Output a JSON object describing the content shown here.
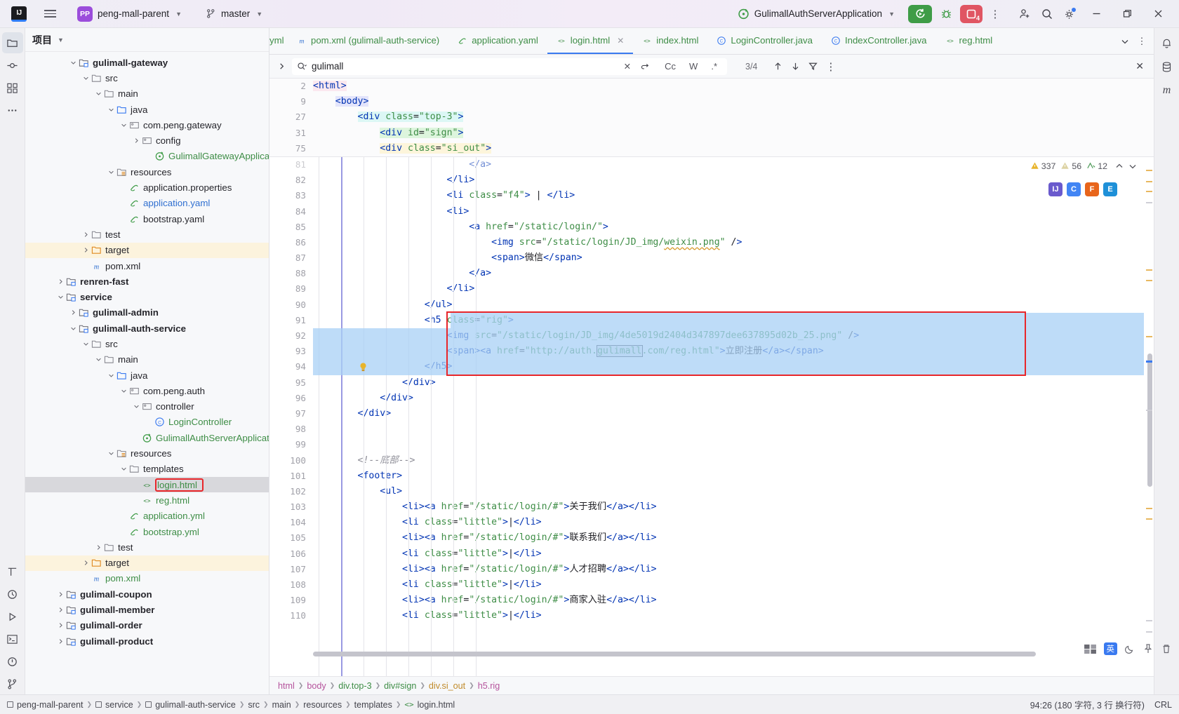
{
  "titlebar": {
    "logo": "IJ",
    "menu_icon": "hamburger-icon",
    "project_badge": "PP",
    "project_name": "peng-mall-parent",
    "branch_icon": "git-branch-icon",
    "branch_name": "master",
    "run_config": "GulimallAuthServerApplication",
    "run_button": "run-icon",
    "debug_button": "debug-icon",
    "stop_button_count": "4",
    "more_button": "more-vertical-icon",
    "account_icon": "add-account-icon",
    "search_icon": "search-icon",
    "settings_icon": "gear-icon",
    "minimize": "minimize-icon",
    "maximize": "restore-icon",
    "close": "close-icon"
  },
  "left_stripe": {
    "items": [
      {
        "name": "project-tool-window",
        "icon": "folder-icon"
      },
      {
        "name": "commit-tool-window",
        "icon": "commit-icon"
      },
      {
        "name": "structure-tool-window",
        "icon": "structure-icon"
      },
      {
        "name": "more-tool-windows",
        "icon": "ellipsis-icon"
      }
    ],
    "bottom_items": [
      {
        "name": "tool-window-todo",
        "icon": "todo-icon"
      },
      {
        "name": "tool-window-profiler",
        "icon": "profiler-icon"
      },
      {
        "name": "tool-window-run",
        "icon": "run-triangle-icon"
      },
      {
        "name": "tool-window-terminal",
        "icon": "terminal-icon"
      },
      {
        "name": "tool-window-problems",
        "icon": "problems-icon"
      },
      {
        "name": "tool-window-git",
        "icon": "git-icon"
      }
    ]
  },
  "right_stripe": {
    "items": [
      {
        "name": "notifications",
        "icon": "bell-icon"
      },
      {
        "name": "database",
        "icon": "database-icon"
      },
      {
        "name": "maven",
        "icon": "maven-m-icon"
      }
    ]
  },
  "project_panel": {
    "title": "项目",
    "chevron": "chevron-down-icon",
    "tree": [
      {
        "depth": 3,
        "arrow": "down",
        "icon": "module",
        "label": "gulimall-gateway",
        "style": "bold"
      },
      {
        "depth": 4,
        "arrow": "down",
        "icon": "folder",
        "label": "src",
        "style": ""
      },
      {
        "depth": 5,
        "arrow": "down",
        "icon": "folder",
        "label": "main",
        "style": ""
      },
      {
        "depth": 6,
        "arrow": "down",
        "icon": "srcfolder",
        "label": "java",
        "style": ""
      },
      {
        "depth": 7,
        "arrow": "down",
        "icon": "package",
        "label": "com.peng.gateway",
        "style": ""
      },
      {
        "depth": 8,
        "arrow": "right",
        "icon": "package",
        "label": "config",
        "style": ""
      },
      {
        "depth": 9,
        "arrow": "none",
        "icon": "springboot",
        "label": "GulimallGatewayApplication",
        "style": "green"
      },
      {
        "depth": 6,
        "arrow": "down",
        "icon": "resfolder",
        "label": "resources",
        "style": ""
      },
      {
        "depth": 7,
        "arrow": "none",
        "icon": "yaml",
        "label": "application.properties",
        "style": ""
      },
      {
        "depth": 7,
        "arrow": "none",
        "icon": "yaml",
        "label": "application.yaml",
        "style": "bluelink"
      },
      {
        "depth": 7,
        "arrow": "none",
        "icon": "yaml",
        "label": "bootstrap.yaml",
        "style": ""
      },
      {
        "depth": 4,
        "arrow": "right",
        "icon": "folder",
        "label": "test",
        "style": ""
      },
      {
        "depth": 4,
        "arrow": "right",
        "icon": "targetfolder",
        "label": "target",
        "style": "",
        "row_style": "target"
      },
      {
        "depth": 4,
        "arrow": "none",
        "icon": "maven",
        "label": "pom.xml",
        "style": ""
      },
      {
        "depth": 2,
        "arrow": "right",
        "icon": "module",
        "label": "renren-fast",
        "style": "bold"
      },
      {
        "depth": 2,
        "arrow": "down",
        "icon": "module",
        "label": "service",
        "style": "bold"
      },
      {
        "depth": 3,
        "arrow": "right",
        "icon": "module",
        "label": "gulimall-admin",
        "style": "bold"
      },
      {
        "depth": 3,
        "arrow": "down",
        "icon": "module",
        "label": "gulimall-auth-service",
        "style": "bold"
      },
      {
        "depth": 4,
        "arrow": "down",
        "icon": "folder",
        "label": "src",
        "style": ""
      },
      {
        "depth": 5,
        "arrow": "down",
        "icon": "folder",
        "label": "main",
        "style": ""
      },
      {
        "depth": 6,
        "arrow": "down",
        "icon": "srcfolder",
        "label": "java",
        "style": ""
      },
      {
        "depth": 7,
        "arrow": "down",
        "icon": "package",
        "label": "com.peng.auth",
        "style": ""
      },
      {
        "depth": 8,
        "arrow": "down",
        "icon": "package",
        "label": "controller",
        "style": ""
      },
      {
        "depth": 9,
        "arrow": "none",
        "icon": "class",
        "label": "LoginController",
        "style": "green"
      },
      {
        "depth": 8,
        "arrow": "none",
        "icon": "springboot",
        "label": "GulimallAuthServerApplication",
        "style": "green"
      },
      {
        "depth": 6,
        "arrow": "down",
        "icon": "resfolder",
        "label": "resources",
        "style": ""
      },
      {
        "depth": 7,
        "arrow": "down",
        "icon": "folder",
        "label": "templates",
        "style": ""
      },
      {
        "depth": 8,
        "arrow": "none",
        "icon": "html",
        "label": "login.html",
        "style": "green",
        "row_style": "selected",
        "boxed": true
      },
      {
        "depth": 8,
        "arrow": "none",
        "icon": "html",
        "label": "reg.html",
        "style": "green"
      },
      {
        "depth": 7,
        "arrow": "none",
        "icon": "yaml",
        "label": "application.yml",
        "style": "green"
      },
      {
        "depth": 7,
        "arrow": "none",
        "icon": "yaml",
        "label": "bootstrap.yml",
        "style": "green"
      },
      {
        "depth": 5,
        "arrow": "right",
        "icon": "folder",
        "label": "test",
        "style": ""
      },
      {
        "depth": 4,
        "arrow": "right",
        "icon": "targetfolder",
        "label": "target",
        "style": "",
        "row_style": "target"
      },
      {
        "depth": 4,
        "arrow": "none",
        "icon": "maven",
        "label": "pom.xml",
        "style": "green"
      },
      {
        "depth": 2,
        "arrow": "right",
        "icon": "module",
        "label": "gulimall-coupon",
        "style": "bold"
      },
      {
        "depth": 2,
        "arrow": "right",
        "icon": "module",
        "label": "gulimall-member",
        "style": "bold"
      },
      {
        "depth": 2,
        "arrow": "right",
        "icon": "module",
        "label": "gulimall-order",
        "style": "bold"
      },
      {
        "depth": 2,
        "arrow": "right",
        "icon": "module",
        "label": "gulimall-product",
        "style": "bold"
      }
    ]
  },
  "tabs": {
    "items": [
      {
        "label": "yml",
        "icon": "yaml-icon",
        "active": false,
        "partial": true
      },
      {
        "label": "pom.xml (gulimall-auth-service)",
        "icon": "maven-icon",
        "active": false
      },
      {
        "label": "application.yaml",
        "icon": "yaml-icon",
        "active": false
      },
      {
        "label": "login.html",
        "icon": "html-icon",
        "active": true,
        "closable": true
      },
      {
        "label": "index.html",
        "icon": "html-icon",
        "active": false
      },
      {
        "label": "LoginController.java",
        "icon": "class-icon",
        "active": false
      },
      {
        "label": "IndexController.java",
        "icon": "class-icon",
        "active": false
      },
      {
        "label": "reg.html",
        "icon": "html-icon",
        "active": false
      }
    ],
    "overflow_icon": "chevron-down-icon",
    "options_icon": "more-vertical-icon"
  },
  "findbar": {
    "expand_icon": "chevron-right-icon",
    "search_icon": "search-dropdown-icon",
    "query": "gulimall",
    "clear_icon": "close-icon",
    "history_icon": "history-icon",
    "match_case": "Cc",
    "words": "W",
    "regex": ".*",
    "match_count": "3/4",
    "prev_icon": "arrow-up-icon",
    "next_icon": "arrow-down-icon",
    "filter_icon": "filter-icon",
    "more_icon": "more-vertical-icon",
    "close_icon": "close-icon"
  },
  "inspection": {
    "warnings": "337",
    "weak_warnings": "56",
    "typos": "12",
    "collapse_icon": "chevron-up-icon",
    "expand_icon": "chevron-down-icon"
  },
  "editor": {
    "sticky_lines": [
      {
        "num": "2",
        "indent": 0,
        "code": "<html>",
        "hl": "hl-tag"
      },
      {
        "num": "9",
        "indent": 1,
        "code": "<body>",
        "hl": "hl-tag2"
      },
      {
        "num": "27",
        "indent": 2,
        "code": "<div class=\"top-3\">",
        "hl": "hl-tag3"
      },
      {
        "num": "31",
        "indent": 3,
        "code": "<div id=\"sign\">",
        "hl": "hl-tag4"
      },
      {
        "num": "75",
        "indent": 3,
        "code": "<div class=\"si_out\">",
        "hl": "hl-tag5"
      }
    ],
    "lines": [
      {
        "num": "81",
        "text": "</a>",
        "indent": 7,
        "clipped": true
      },
      {
        "num": "82",
        "text": "</li>",
        "indent": 6
      },
      {
        "num": "83",
        "text": "<li class=\"f4\"> | </li>",
        "indent": 6
      },
      {
        "num": "84",
        "text": "<li>",
        "indent": 6
      },
      {
        "num": "85",
        "text": "<a href=\"/static/login/\">",
        "indent": 7
      },
      {
        "num": "86",
        "text": "<img src=\"/static/login/JD_img/weixin.png\" />",
        "indent": 8
      },
      {
        "num": "87",
        "text": "<span>微信</span>",
        "indent": 8
      },
      {
        "num": "88",
        "text": "</a>",
        "indent": 7
      },
      {
        "num": "89",
        "text": "</li>",
        "indent": 6
      },
      {
        "num": "90",
        "text": "</ul>",
        "indent": 5
      },
      {
        "num": "91",
        "text": "<h5 class=\"rig\">",
        "indent": 5,
        "selected": true
      },
      {
        "num": "92",
        "text": "<img src=\"/static/login/JD_img/4de5019d2404d347897dee637895d02b_25.png\" />",
        "indent": 6,
        "selected": true
      },
      {
        "num": "93",
        "text": "<span><a href=\"http://auth.gulimall.com/reg.html\">立即注册</a></span>",
        "indent": 6,
        "selected": true
      },
      {
        "num": "94",
        "text": "</h5>",
        "indent": 5,
        "selected": true,
        "caret": true,
        "bulb": true
      },
      {
        "num": "95",
        "text": "</div>",
        "indent": 4
      },
      {
        "num": "96",
        "text": "</div>",
        "indent": 3
      },
      {
        "num": "97",
        "text": "</div>",
        "indent": 2
      },
      {
        "num": "98",
        "text": "",
        "indent": 0
      },
      {
        "num": "99",
        "text": "",
        "indent": 0
      },
      {
        "num": "100",
        "text": "<!--底部-->",
        "indent": 2,
        "comment": true
      },
      {
        "num": "101",
        "text": "<footer>",
        "indent": 2
      },
      {
        "num": "102",
        "text": "<ul>",
        "indent": 3
      },
      {
        "num": "103",
        "text": "<li><a href=\"/static/login/#\">关于我们</a></li>",
        "indent": 4
      },
      {
        "num": "104",
        "text": "<li class=\"little\">|</li>",
        "indent": 4
      },
      {
        "num": "105",
        "text": "<li><a href=\"/static/login/#\">联系我们</a></li>",
        "indent": 4
      },
      {
        "num": "106",
        "text": "<li class=\"little\">|</li>",
        "indent": 4
      },
      {
        "num": "107",
        "text": "<li><a href=\"/static/login/#\">人才招聘</a></li>",
        "indent": 4
      },
      {
        "num": "108",
        "text": "<li class=\"little\">|</li>",
        "indent": 4
      },
      {
        "num": "109",
        "text": "<li><a href=\"/static/login/#\">商家入驻</a></li>",
        "indent": 4
      },
      {
        "num": "110",
        "text": "<li class=\"little\">|</li>",
        "indent": 4
      }
    ]
  },
  "breadcrumb": {
    "items": [
      "html",
      "body",
      "div.top-3",
      "div#sign",
      "div.si_out",
      "h5.rig"
    ]
  },
  "statusbar": {
    "path": [
      "peng-mall-parent",
      "service",
      "gulimall-auth-service",
      "src",
      "main",
      "resources",
      "templates",
      "login.html"
    ],
    "caret_position": "94:26 (180 字符, 3 行 换行符)",
    "line_separator": "CRL",
    "keyboard_layout": "英",
    "layout_icon": "keyboard-layout-icon",
    "moon_icon": "moon-icon",
    "pin_icon": "pin-icon",
    "trash_icon": "trash-icon"
  },
  "colors": {
    "accent": "#3a7af0",
    "run_green": "#3f9c47",
    "stop_red": "#e05563",
    "highlight_box": "#e8262a",
    "selection_blue": "#a8d0f5",
    "find_hit": "#fbe6a9",
    "string_green": "#3e8d46",
    "tag_blue": "#0033b3"
  }
}
